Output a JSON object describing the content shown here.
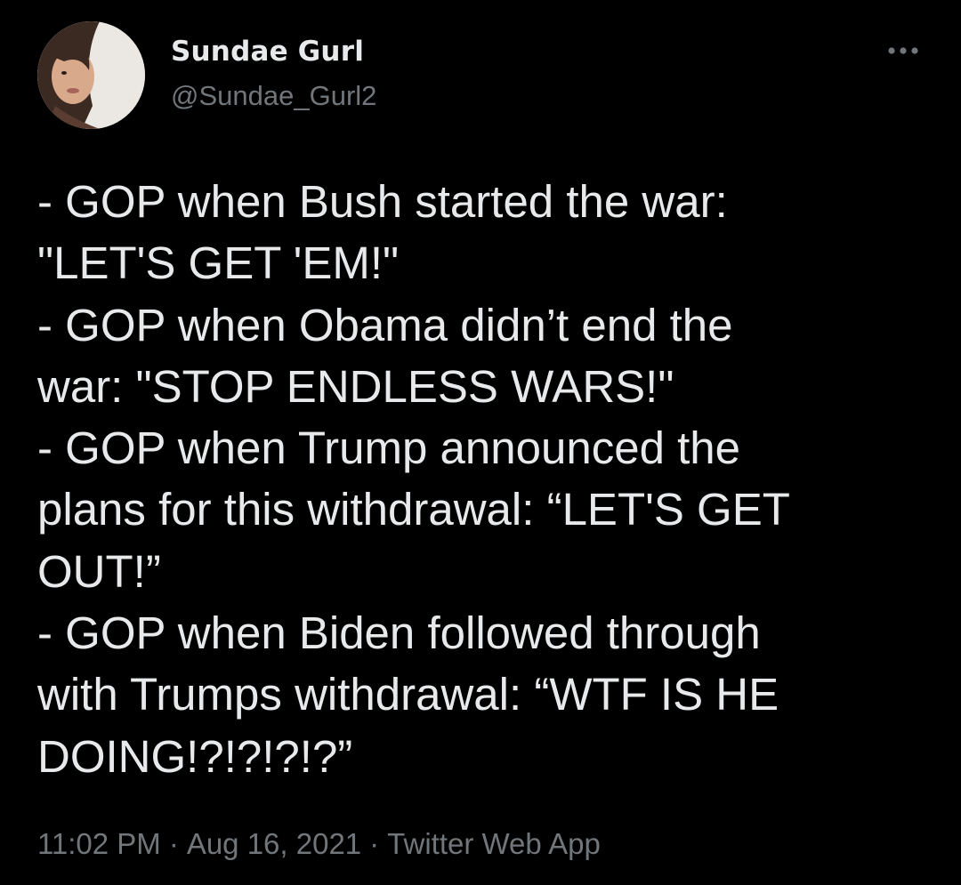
{
  "author": {
    "display_name": "Sundae Gurl",
    "handle": "@Sundae_Gurl2",
    "avatar_icon": "profile-photo"
  },
  "menu": {
    "icon": "more-options-icon"
  },
  "tweet": {
    "lines": [
      "- GOP when Bush started the war:",
      "\"LET'S GET 'EM!\"",
      "- GOP when Obama didn’t end the",
      "war: \"STOP ENDLESS WARS!\"",
      "- GOP when Trump announced the",
      "plans for this withdrawal: “LET'S GET",
      "OUT!”",
      "- GOP when Biden followed through",
      "with Trumps withdrawal: “WTF IS HE",
      "DOING!?!?!?!?”"
    ]
  },
  "meta": {
    "time": "11:02 PM",
    "separator": "·",
    "date": "Aug 16, 2021",
    "source": "Twitter Web App"
  },
  "colors": {
    "background": "#000000",
    "primary_text": "#e7e9ea",
    "secondary_text": "#71767b"
  }
}
